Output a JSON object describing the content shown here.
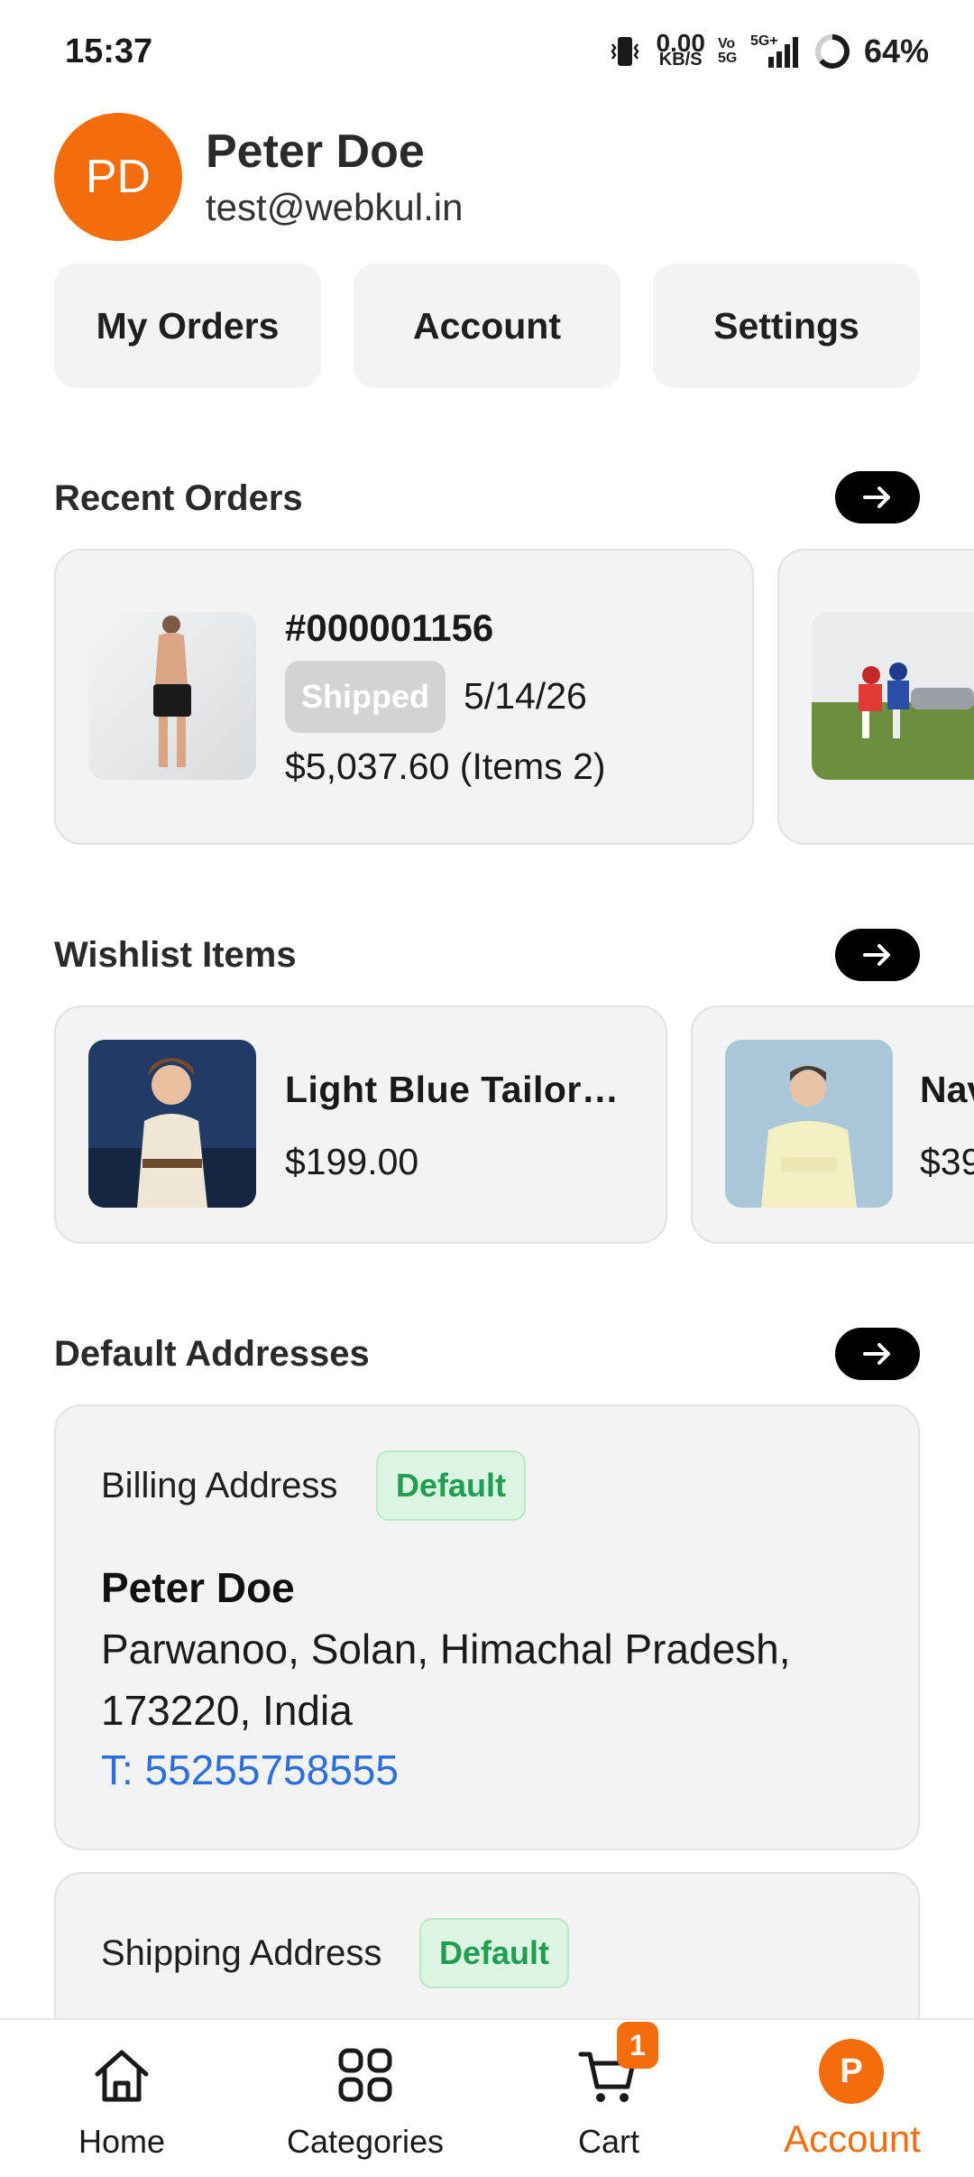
{
  "status_bar": {
    "time": "15:37",
    "net_speed": "0.00",
    "net_unit": "KB/S",
    "volte": "Vo 5G",
    "signal": "5G+",
    "battery": "64%"
  },
  "profile": {
    "initials": "PD",
    "name": "Peter Doe",
    "email": "test@webkul.in"
  },
  "quick_actions": {
    "orders": "My Orders",
    "account": "Account",
    "settings": "Settings"
  },
  "recent_orders": {
    "title": "Recent Orders",
    "items": [
      {
        "order_no": "#000001156",
        "status": "Shipped",
        "date": "5/14/26",
        "total": "$5,037.60 (Items 2)"
      }
    ]
  },
  "wishlist": {
    "title": "Wishlist Items",
    "items": [
      {
        "name": "Light Blue Tailore…",
        "price": "$199.00"
      },
      {
        "name": "Nav",
        "price": "$39"
      }
    ]
  },
  "addresses": {
    "title": "Default Addresses",
    "billing": {
      "label": "Billing Address",
      "badge": "Default",
      "name": "Peter Doe",
      "line1": "Parwanoo, Solan,  Himachal Pradesh,",
      "line2": "173220, India",
      "phone": "T: 55255758555"
    },
    "shipping": {
      "label": "Shipping Address",
      "badge": "Default"
    }
  },
  "bottom_nav": {
    "home": "Home",
    "categories": "Categories",
    "cart": "Cart",
    "cart_count": "1",
    "account": "Account",
    "account_initial": "P"
  },
  "colors": {
    "accent": "#f36d0d",
    "card_bg": "#f3f3f3",
    "success": "#1e9e4e",
    "link": "#2a6fe0"
  }
}
